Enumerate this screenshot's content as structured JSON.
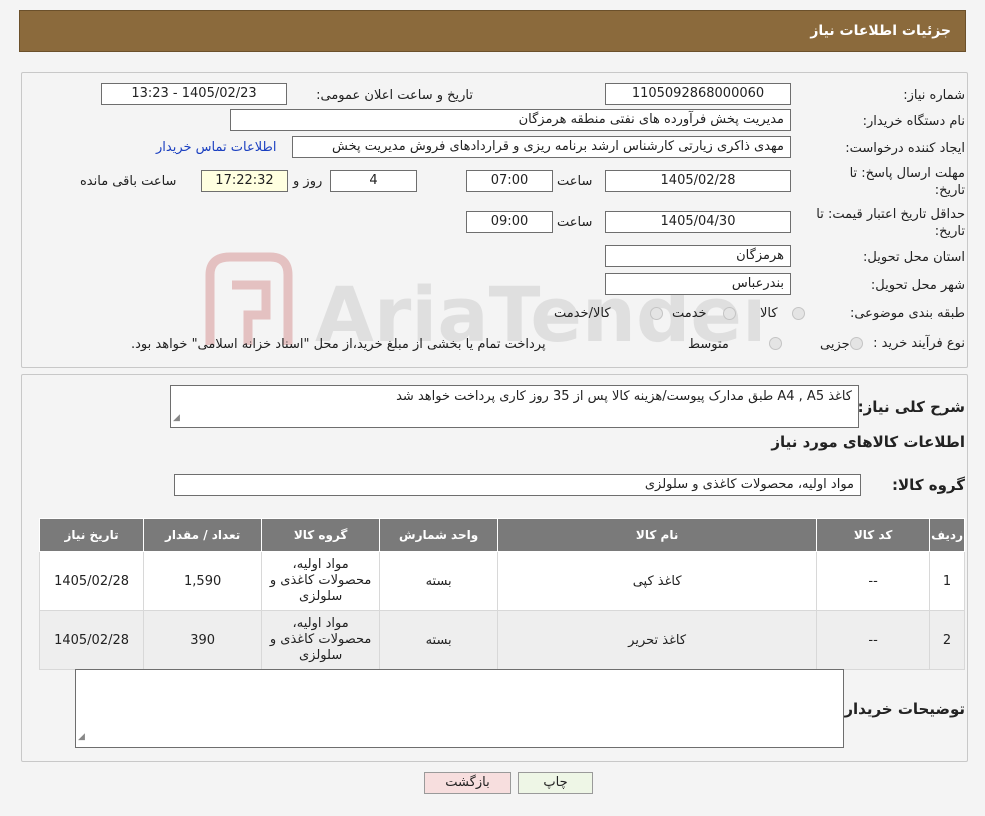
{
  "header": {
    "title": "جزئیات اطلاعات نیاز"
  },
  "form": {
    "need_number_label": "شماره نیاز:",
    "need_number": "1105092868000060",
    "announce_label": "تاریخ و ساعت اعلان عمومی:",
    "announce_value": "1405/02/23 - 13:23",
    "buyer_org_label": "نام دستگاه خریدار:",
    "buyer_org": "مدیریت پخش فرآورده های نفتی منطقه هرمزگان",
    "creator_label": "ایجاد کننده درخواست:",
    "creator": "مهدی ذاکری زیارتی کارشناس ارشد برنامه ریزی و قراردادهای فروش مدیریت پخش",
    "contact_link": "اطلاعات تماس خریدار",
    "reply_deadline_label_1": "مهلت ارسال پاسخ: تا",
    "reply_deadline_label_2": "تاریخ:",
    "reply_date": "1405/02/28",
    "time_label": "ساعت",
    "reply_time": "07:00",
    "days_value": "4",
    "days_label": "روز و",
    "remaining_time": "17:22:32",
    "remaining_label": "ساعت باقی مانده",
    "price_validity_label_1": "حداقل تاریخ اعتبار قیمت: تا",
    "price_validity_label_2": "تاریخ:",
    "validity_date": "1405/04/30",
    "validity_time": "09:00",
    "province_label": "استان محل تحویل:",
    "province": "هرمزگان",
    "city_label": "شهر محل تحویل:",
    "city": "بندرعباس",
    "category_label": "طبقه بندی موضوعی:",
    "category_options": [
      "کالا",
      "خدمت",
      "کالا/خدمت"
    ],
    "process_label": "نوع فرآیند خرید :",
    "process_options": [
      "جزیی",
      "متوسط"
    ],
    "process_note": "پرداخت تمام یا بخشی از مبلغ خرید،از محل \"اسناد خزانه اسلامی\" خواهد بود."
  },
  "details": {
    "description_label": "شرح کلی نیاز:",
    "description": "کاغذ  A4 , A5  طبق مدارک پیوست/هزینه کالا پس از 35 روز کاری پرداخت خواهد شد",
    "goods_info_title": "اطلاعات کالاهای مورد نیاز",
    "goods_group_label": "گروه کالا:",
    "goods_group": "مواد اولیه، محصولات کاغذی و سلولزی",
    "table": {
      "headers": [
        "ردیف",
        "کد کالا",
        "نام کالا",
        "واحد شمارش",
        "گروه کالا",
        "تعداد / مقدار",
        "تاریخ نیاز"
      ],
      "rows": [
        {
          "row": "1",
          "code": "--",
          "name": "کاغذ کپی",
          "unit": "بسته",
          "group": "مواد اولیه، محصولات کاغذی و سلولزی",
          "qty": "1,590",
          "date": "1405/02/28"
        },
        {
          "row": "2",
          "code": "--",
          "name": "کاغذ تحریر",
          "unit": "بسته",
          "group": "مواد اولیه، محصولات کاغذی و سلولزی",
          "qty": "390",
          "date": "1405/02/28"
        }
      ]
    },
    "buyer_notes_label": "توضیحات خریدار:",
    "buyer_notes": ""
  },
  "buttons": {
    "print": "چاپ",
    "back": "بازگشت"
  },
  "watermark": {
    "text": "AriaTender.neT"
  },
  "colors": {
    "header_bg": "#8b6a3c",
    "link": "#1a3fc0",
    "table_header": "#7a7a7a",
    "back_btn": "#f7dede",
    "print_btn": "#eef6e6"
  }
}
